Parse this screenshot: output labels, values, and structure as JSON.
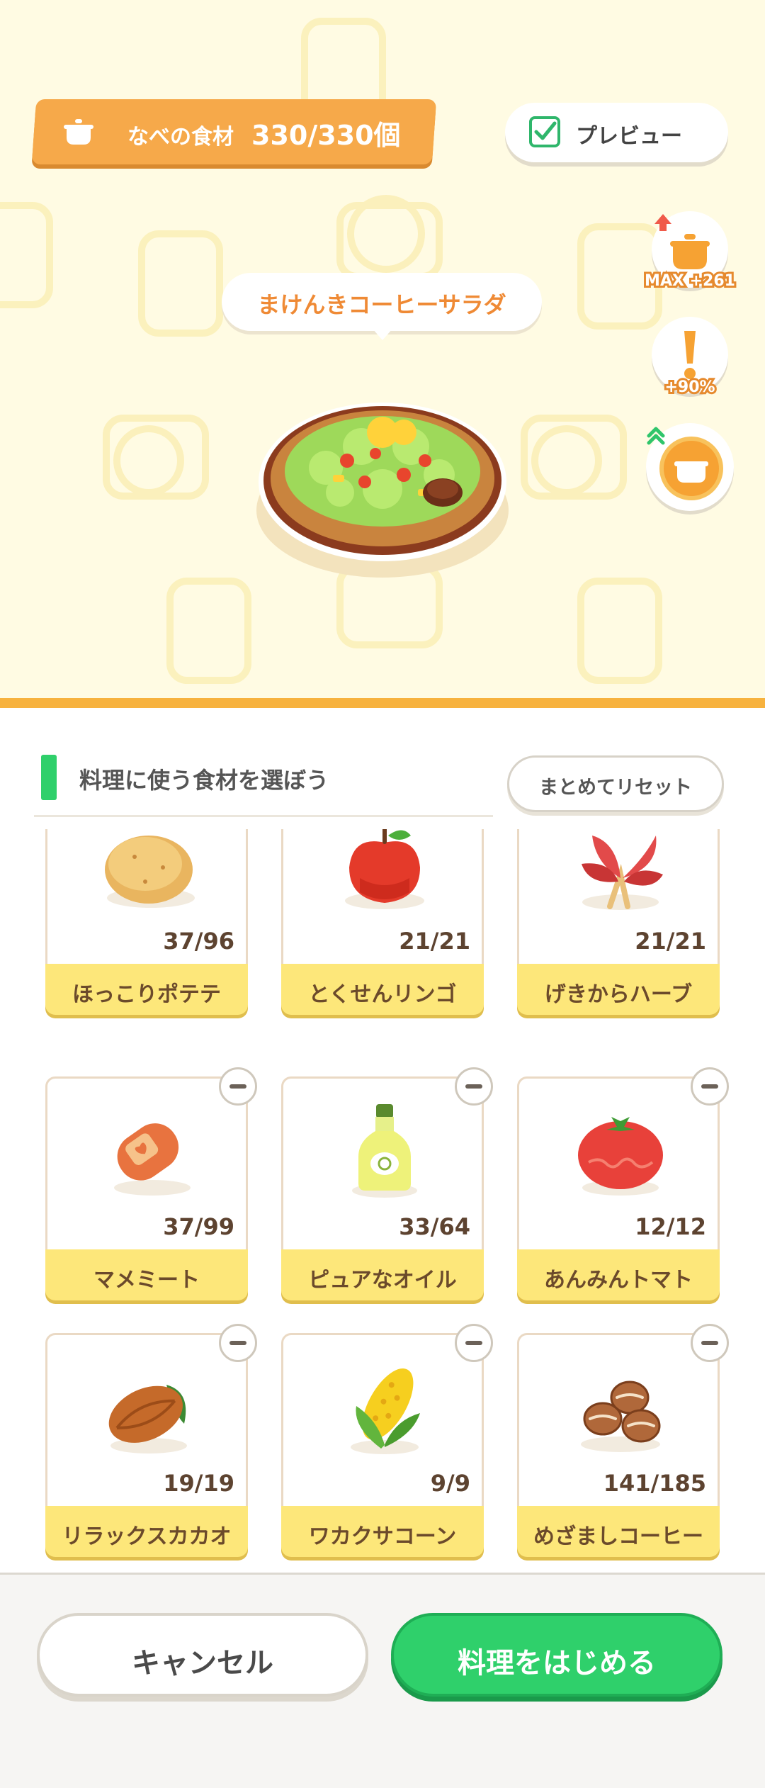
{
  "header": {
    "pot_label": "なべの食材",
    "pot_count": "330/330個",
    "preview_label": "プレビュー",
    "preview_checked": true
  },
  "side_buttons": [
    {
      "icon": "pot-upgrade-icon",
      "label": "MAX +261"
    },
    {
      "icon": "exclamation-icon",
      "label": "+90%"
    },
    {
      "icon": "pot-boost-icon",
      "label": ""
    }
  ],
  "dish": {
    "name": "まけんきコーヒーサラダ",
    "icon": "salad-dish-icon"
  },
  "section": {
    "title": "料理に使う食材を選ぼう",
    "reset_label": "まとめてリセット"
  },
  "ingredients": [
    {
      "name": "ほっこりポテテ",
      "count": "37/96",
      "icon": "potato-icon"
    },
    {
      "name": "とくせんリンゴ",
      "count": "21/21",
      "icon": "apple-icon"
    },
    {
      "name": "げきからハーブ",
      "count": "21/21",
      "icon": "herb-icon"
    },
    {
      "name": "マメミート",
      "count": "37/99",
      "icon": "bean-meat-icon"
    },
    {
      "name": "ピュアなオイル",
      "count": "33/64",
      "icon": "oil-bottle-icon"
    },
    {
      "name": "あんみんトマト",
      "count": "12/12",
      "icon": "tomato-icon"
    },
    {
      "name": "リラックスカカオ",
      "count": "19/19",
      "icon": "cacao-icon"
    },
    {
      "name": "ワカクサコーン",
      "count": "9/9",
      "icon": "corn-icon"
    },
    {
      "name": "めざましコーヒー",
      "count": "141/185",
      "icon": "coffee-beans-icon"
    }
  ],
  "footer": {
    "cancel_label": "キャンセル",
    "start_label": "料理をはじめる"
  },
  "colors": {
    "accent_orange": "#f6a94a",
    "accent_green": "#2fd06b",
    "card_footer": "#fde77a"
  }
}
